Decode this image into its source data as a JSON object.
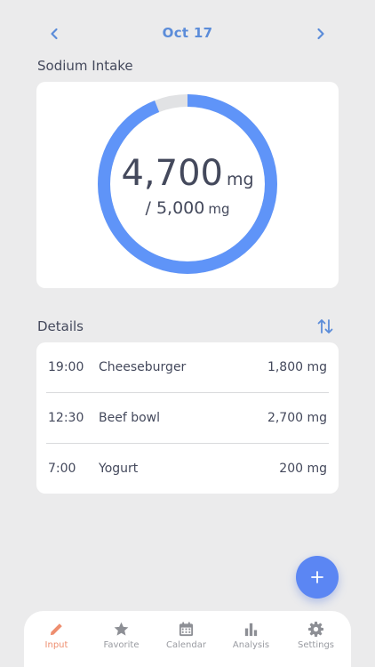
{
  "header": {
    "date": "Oct 17",
    "prev_icon": "chevron-left-icon",
    "next_icon": "chevron-right-icon"
  },
  "intake": {
    "section_title": "Sodium Intake",
    "consumed": "4,700",
    "consumed_unit": "mg",
    "goal": "/ 5,000",
    "goal_unit": "mg",
    "progress_fraction": 0.94
  },
  "details": {
    "section_title": "Details",
    "sort_icon": "sort-arrows-icon",
    "rows": [
      {
        "time": "19:00",
        "food": "Cheeseburger",
        "amount": "1,800 mg"
      },
      {
        "time": "12:30",
        "food": "Beef bowl",
        "amount": "2,700 mg"
      },
      {
        "time": "7:00",
        "food": "Yogurt",
        "amount": "200 mg"
      }
    ]
  },
  "fab": {
    "icon": "plus-icon"
  },
  "tabbar": {
    "tabs": [
      {
        "label": "Input",
        "icon": "pencil-icon",
        "active": true
      },
      {
        "label": "Favorite",
        "icon": "star-icon",
        "active": false
      },
      {
        "label": "Calendar",
        "icon": "calendar-icon",
        "active": false
      },
      {
        "label": "Analysis",
        "icon": "bar-chart-icon",
        "active": false
      },
      {
        "label": "Settings",
        "icon": "gear-icon",
        "active": false
      }
    ]
  },
  "colors": {
    "accent": "#5b8cd9",
    "ring_fill": "#5f94f8",
    "ring_track": "#e1e2e4",
    "active_tab": "#ee8e6f",
    "inactive_tab": "#999ba1",
    "fab": "#5b86f3"
  }
}
